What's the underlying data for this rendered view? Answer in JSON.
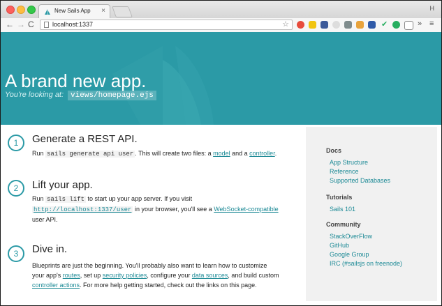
{
  "browser": {
    "tab_title": "New Sails App",
    "tab_close": "×",
    "url": "localhost:1337",
    "profile_label": "H"
  },
  "hero": {
    "title": "A brand new app.",
    "subtitle_prefix": "You're looking at:",
    "subtitle_code": "views/homepage.ejs"
  },
  "steps": [
    {
      "number": "1",
      "title": "Generate a REST API.",
      "parts": {
        "a": "Run ",
        "code": "sails generate api user",
        "b": ". This will create two files: a ",
        "link1": "model",
        "c": " and a ",
        "link2": "controller",
        "d": "."
      }
    },
    {
      "number": "2",
      "title": "Lift your app.",
      "parts": {
        "a": "Run ",
        "code": "sails lift",
        "b": " to start up your app server. If you visit",
        "link_url": "http://localhost:1337/user",
        "c": " in your browser, you'll see a ",
        "link1": "WebSocket-compatible",
        "d": " user API."
      }
    },
    {
      "number": "3",
      "title": "Dive in.",
      "parts": {
        "a": "Blueprints are just the beginning. You'll probably also want to learn how to customize your app's ",
        "link1": "routes",
        "b": ", set up ",
        "link2": "security policies",
        "c": ", configure your ",
        "link3": "data sources",
        "d": ", and build custom ",
        "link4": "controller actions",
        "e": ". For more help getting started, check out the links on this page."
      }
    }
  ],
  "sidebar": {
    "docs_heading": "Docs",
    "docs": [
      "App Structure",
      "Reference",
      "Supported Databases"
    ],
    "tutorials_heading": "Tutorials",
    "tutorials": [
      "Sails 101"
    ],
    "community_heading": "Community",
    "community": [
      "StackOverFlow",
      "GitHub",
      "Google Group",
      "IRC (#sailsjs on freenode)"
    ]
  },
  "colors": {
    "accent": "#2b9aa6",
    "link": "#1d8a96",
    "sidebar_bg": "#f1f1f1"
  },
  "icons": [
    "back-arrow-icon",
    "forward-arrow-icon",
    "reload-icon",
    "page-icon",
    "bookmark-star-icon",
    "menu-icon"
  ]
}
